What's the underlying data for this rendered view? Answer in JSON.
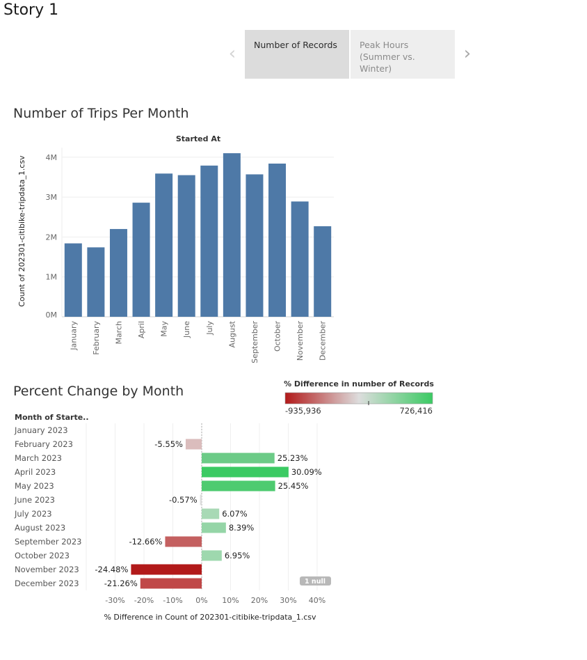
{
  "story": {
    "title": "Story 1",
    "points": [
      {
        "line1": "Number of Records",
        "line2": ""
      },
      {
        "line1": "Peak Hours",
        "line2": "(Summer vs. Winter)"
      }
    ]
  },
  "chart_data": [
    {
      "type": "bar",
      "title": "Number of Trips Per Month",
      "column_header": "Started At",
      "ylabel": "Count of 202301-citibike-tripdata_1.csv",
      "categories": [
        "January",
        "February",
        "March",
        "April",
        "May",
        "June",
        "July",
        "August",
        "September",
        "October",
        "November",
        "December"
      ],
      "values": [
        1840000,
        1740000,
        2200000,
        2860000,
        3590000,
        3550000,
        3790000,
        4100000,
        3570000,
        3840000,
        2890000,
        2270000
      ],
      "yticks": [
        "0M",
        "1M",
        "2M",
        "3M",
        "4M"
      ],
      "ylim": [
        0,
        4200000
      ],
      "color": "#4e79a7",
      "grid": true
    },
    {
      "type": "bar",
      "orientation": "horizontal",
      "title": "Percent Change by Month",
      "row_header": "Month of Starte..",
      "xlabel": "% Difference in Count of 202301-citibike-tripdata_1.csv",
      "categories": [
        "January 2023",
        "February 2023",
        "March 2023",
        "April 2023",
        "May 2023",
        "June 2023",
        "July 2023",
        "August 2023",
        "September 2023",
        "October 2023",
        "November 2023",
        "December 2023"
      ],
      "values": [
        null,
        -5.55,
        25.23,
        30.09,
        25.45,
        -0.57,
        6.07,
        8.39,
        -12.66,
        6.95,
        -24.48,
        -21.26
      ],
      "labels": [
        "",
        "-5.55%",
        "25.23%",
        "30.09%",
        "25.45%",
        "-0.57%",
        "6.07%",
        "8.39%",
        "-12.66%",
        "6.95%",
        "-24.48%",
        "-21.26%"
      ],
      "bar_colors": [
        "",
        "#dbbdbd",
        "#6ccb87",
        "#3bca63",
        "#4ecb70",
        "#dcdcdc",
        "#a8d9b5",
        "#95d5a7",
        "#c46060",
        "#9ed8ae",
        "#b21a1a",
        "#c04848"
      ],
      "xticks": [
        "-30%",
        "-20%",
        "-10%",
        "0%",
        "10%",
        "20%",
        "30%",
        "40%"
      ],
      "xlim": [
        -40,
        45
      ],
      "null_badge": "1 null",
      "legend": {
        "title": "% Difference in number of Records",
        "min_label": "-935,936",
        "max_label": "726,416",
        "colors": [
          "#b21a1a",
          "#dddddd",
          "#3bca63"
        ]
      }
    }
  ]
}
